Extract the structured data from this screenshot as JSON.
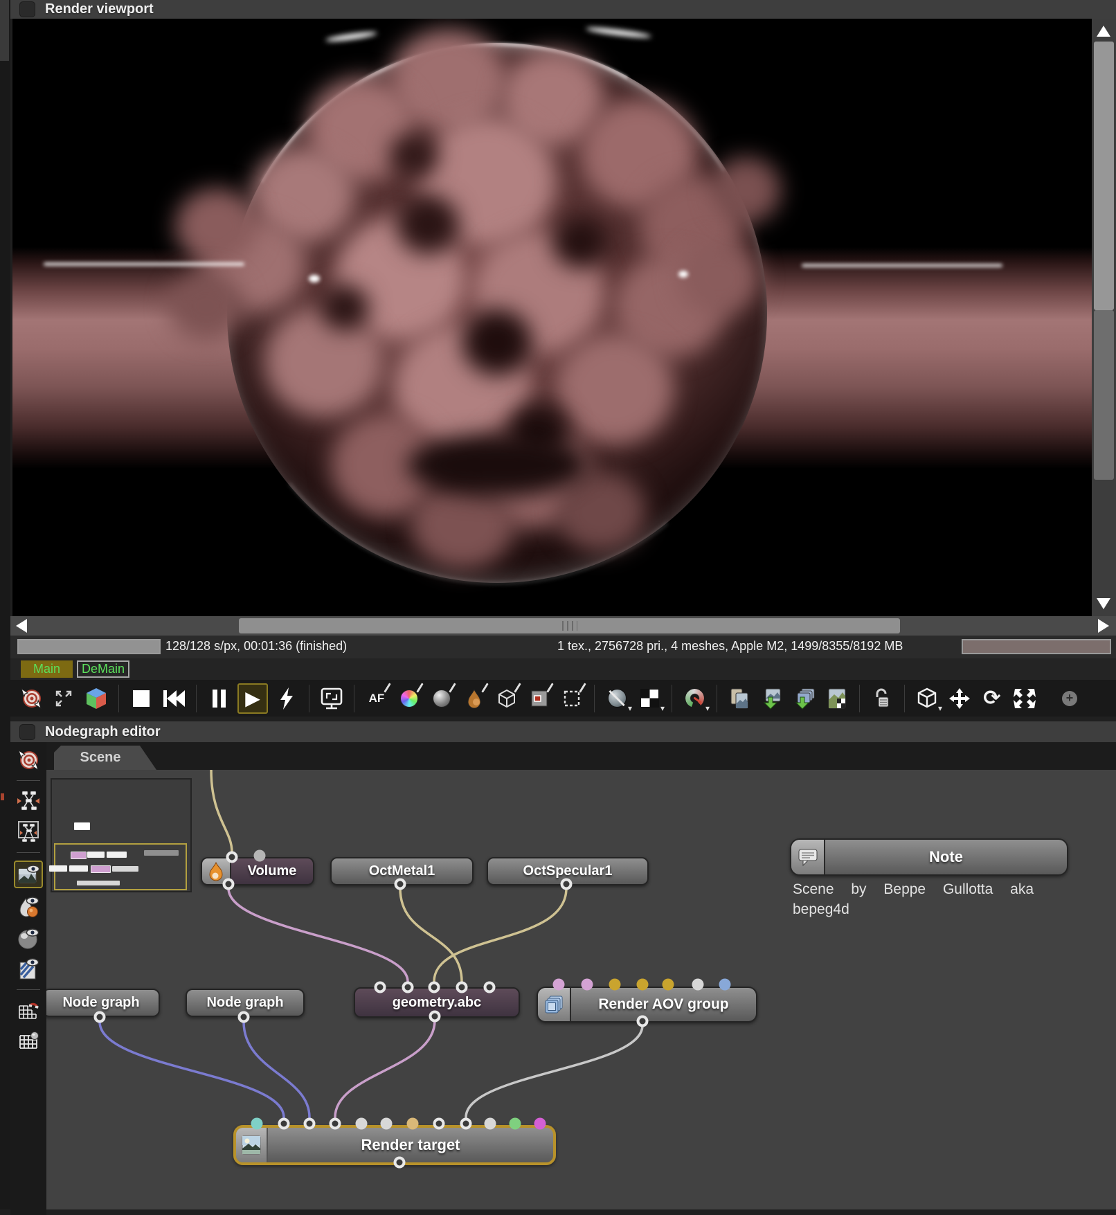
{
  "viewport_panel": {
    "title": "Render viewport",
    "status": {
      "samples": "128/128 s/px, 00:01:36 (finished)",
      "stats": "1 tex., 2756728 pri., 4 meshes, Apple M2, 1499/8355/8192 MB"
    },
    "tabs": [
      {
        "label": "Main"
      },
      {
        "label": "DeMain"
      }
    ]
  },
  "toolbar": {
    "af_label": "AF"
  },
  "icons": {
    "play": "▶",
    "caret": "▾",
    "rotate": "⟳",
    "plus": "+"
  },
  "nodegraph_panel": {
    "title": "Nodegraph editor",
    "tab_label": "Scene",
    "nodes": {
      "volume": {
        "label": "Volume"
      },
      "octmetal": {
        "label": "OctMetal1"
      },
      "octspecular": {
        "label": "OctSpecular1"
      },
      "note": {
        "label": "Note",
        "body": "Scene by Beppe Gullotta aka bepeg4d"
      },
      "nodegraph1": {
        "label": "Node graph"
      },
      "nodegraph2": {
        "label": "Node graph"
      },
      "geometry": {
        "label": "geometry.abc"
      },
      "aov": {
        "label": "Render AOV group"
      },
      "rendertarget": {
        "label": "Render target"
      }
    }
  },
  "colors": {
    "selection_gold": "#b8922a",
    "tab_active_bg": "#7d6a12",
    "tab_text_green": "#5be05b",
    "wire_beige": "#cfc292",
    "wire_pink": "#c99fca",
    "wire_blue": "#7b7bd0",
    "wire_white": "#c8c8c8"
  }
}
